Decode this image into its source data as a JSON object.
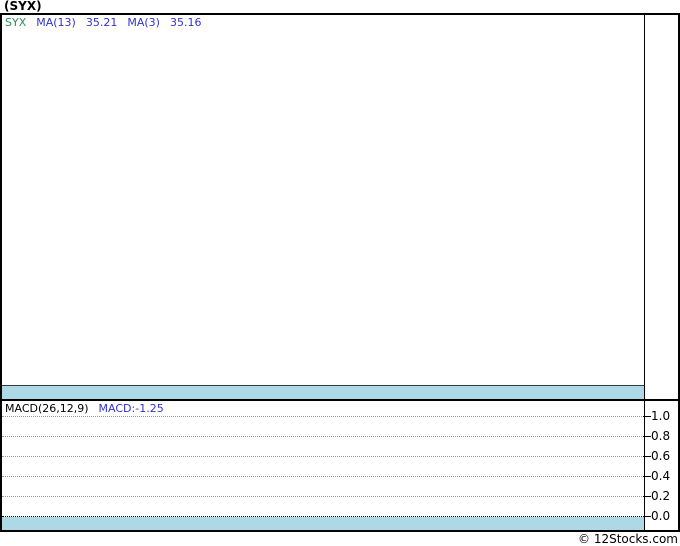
{
  "page": {
    "title": "(SYX)",
    "footer_credit": "© 12Stocks.com"
  },
  "colors": {
    "ticker_green": "#2E8B57",
    "indicator_blue": "#3333CC",
    "band_blue": "#ADD8E6",
    "grid_gray": "#9A9A9A",
    "border_black": "#000000"
  },
  "main_chart": {
    "legend": {
      "ticker": "SYX",
      "ma13_label": "MA(13)",
      "ma13_value": "35.21",
      "ma3_label": "MA(3)",
      "ma3_value": "35.16"
    }
  },
  "macd_chart": {
    "legend": {
      "indicator_label": "MACD(26,12,9)",
      "value_label": "MACD:-1.25"
    },
    "y_ticks": [
      "1.0",
      "0.8",
      "0.6",
      "0.4",
      "0.2",
      "0.0"
    ]
  },
  "chart_data": [
    {
      "type": "line",
      "panel": "price",
      "title": "(SYX)",
      "legend": [
        "SYX",
        "MA(13) 35.21",
        "MA(3) 35.16"
      ],
      "legend_position": "top-left",
      "series": [],
      "grid": false,
      "yticks": []
    },
    {
      "type": "line",
      "panel": "MACD",
      "legend": [
        "MACD(26,12,9)",
        "MACD:-1.25"
      ],
      "legend_position": "top-left",
      "series": [],
      "grid": true,
      "ylim": [
        0.0,
        1.0
      ],
      "yticks": [
        1.0,
        0.8,
        0.6,
        0.4,
        0.2,
        0.0
      ],
      "zero_line": 0.0,
      "macd_value": -1.25
    }
  ]
}
